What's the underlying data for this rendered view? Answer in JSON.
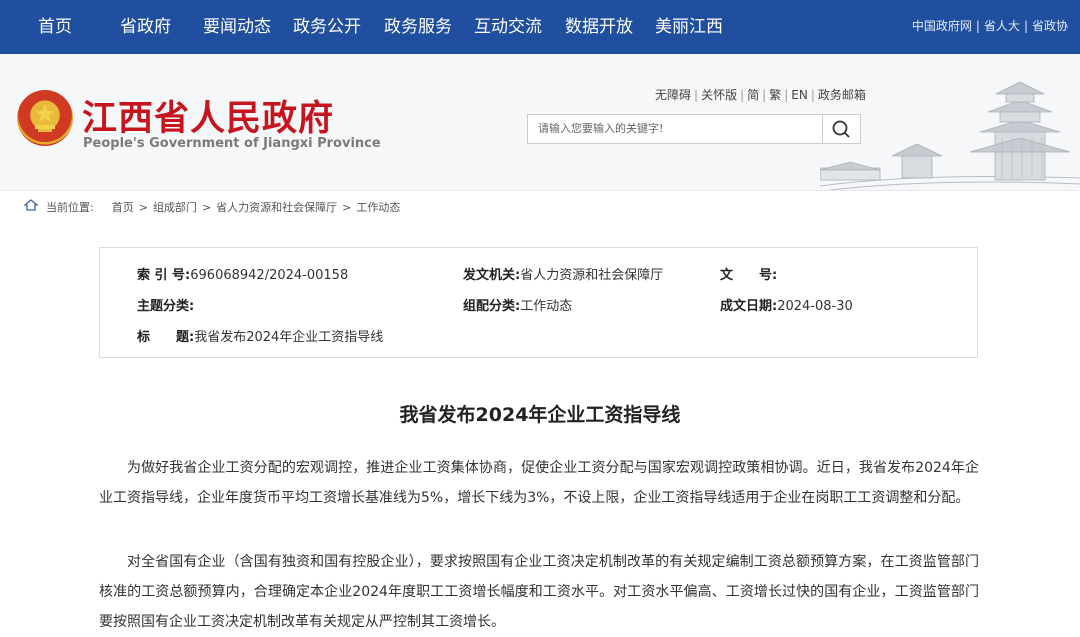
{
  "topnav": {
    "items": [
      "首页",
      "省政府",
      "要闻动态",
      "政务公开",
      "政务服务",
      "互动交流",
      "数据开放",
      "美丽江西"
    ],
    "right_links": [
      "中国政府网",
      "省人大",
      "省政协"
    ]
  },
  "header": {
    "title": "江西省人民政府",
    "subtitle": "People's Government of Jiangxi Province",
    "util_links": [
      "无障碍",
      "关怀版",
      "简",
      "繁",
      "EN",
      "政务邮箱"
    ],
    "search_placeholder": "请输入您要输入的关键字!"
  },
  "breadcrumb": {
    "label": "当前位置:",
    "items": [
      "首页",
      "组成部门",
      "省人力资源和社会保障厅",
      "工作动态"
    ]
  },
  "info": {
    "index_label": "索 引 号:",
    "index_value": "696068942/2024-00158",
    "issuer_label": "发文机关:",
    "issuer_value": "省人力资源和社会保障厅",
    "docno_label": "文　　号:",
    "docno_value": "",
    "topic_label": "主题分类:",
    "topic_value": "",
    "category_label": "组配分类:",
    "category_value": "工作动态",
    "date_label": "成文日期:",
    "date_value": "2024-08-30",
    "title_label": "标　　题:",
    "title_value": "我省发布2024年企业工资指导线"
  },
  "article": {
    "title": "我省发布2024年企业工资指导线",
    "paragraphs": [
      "为做好我省企业工资分配的宏观调控，推进企业工资集体协商，促使企业工资分配与国家宏观调控政策相协调。近日，我省发布2024年企业工资指导线，企业年度货币平均工资增长基准线为5%，增长下线为3%，不设上限，企业工资指导线适用于企业在岗职工工资调整和分配。",
      "对全省国有企业（含国有独资和国有控股企业），要求按照国有企业工资决定机制改革的有关规定编制工资总额预算方案，在工资监管部门核准的工资总额预算内，合理确定本企业2024年度职工工资增长幅度和工资水平。对工资水平偏高、工资增长过快的国有企业，工资监管部门要按照国有企业工资决定机制改革有关规定从严控制其工资增长。"
    ]
  },
  "colors": {
    "nav_bg": "#1f4f9e",
    "brand_red": "#c8151d",
    "header_bg": "#f6f7f9"
  }
}
